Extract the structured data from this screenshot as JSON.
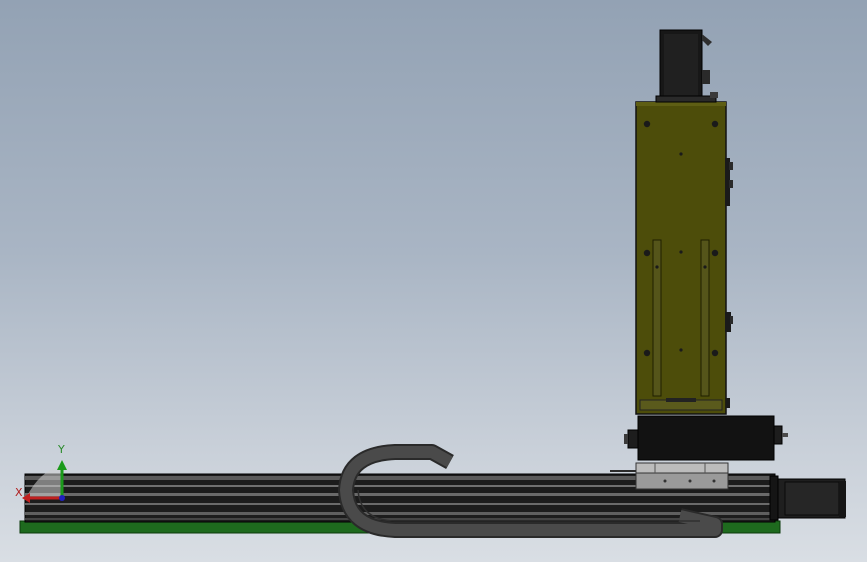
{
  "viewport": {
    "description_colors": {
      "background_top": "#93a2b4",
      "background_bottom": "#d9dee4",
      "frame_body": "#4d4d0a",
      "rail_dark": "#1c1c1c",
      "base_plate": "#1e6a1e",
      "cable_chain": "#3a3a3a",
      "carriage_plate": "#9a9a9a"
    }
  },
  "triad": {
    "x_label": "X",
    "y_label": "Y",
    "x_color": "#c02020",
    "y_color": "#1a9a1a",
    "z_color": "#2020c0"
  }
}
